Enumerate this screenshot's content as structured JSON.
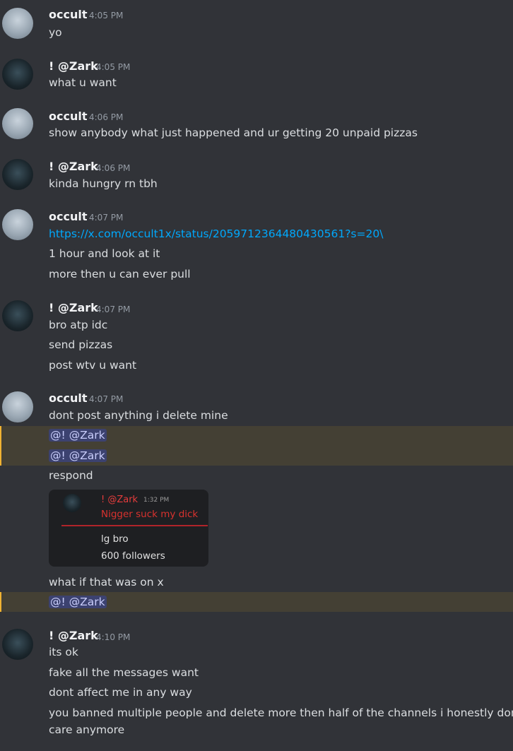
{
  "messages": [
    {
      "author": "occult",
      "time": "4:05 PM",
      "lines": [
        "yo"
      ]
    },
    {
      "author": "! @Zark",
      "time": "4:05 PM",
      "lines": [
        "what u want"
      ]
    },
    {
      "author": "occult",
      "time": "4:06 PM",
      "lines": [
        "show anybody what just happened and ur getting 20 unpaid pizzas"
      ]
    },
    {
      "author": "! @Zark",
      "time": "4:06 PM",
      "lines": [
        "kinda hungry rn tbh"
      ]
    },
    {
      "author": "occult",
      "time": "4:07 PM",
      "link": "https://x.com/occult1x/status/2059712364480430561?s=20\\",
      "lines": [
        "1 hour and look at it",
        "more then u can ever pull"
      ]
    },
    {
      "author": "! @Zark",
      "time": "4:07 PM",
      "lines": [
        "bro atp idc",
        "send pizzas",
        "post wtv u want"
      ]
    },
    {
      "author": "occult",
      "time": "4:07 PM",
      "lines": [
        "dont post anything i delete mine",
        "respond",
        "what if that was on x"
      ],
      "mentions": [
        "@! @Zark",
        "@! @Zark",
        "@! @Zark"
      ]
    },
    {
      "author": "! @Zark",
      "time": "4:10 PM",
      "lines": [
        "its ok",
        "fake all the messages want",
        "dont affect me in any way",
        "you banned multiple people and delete more then half of the channels i honestly don't",
        "care anymore"
      ]
    }
  ],
  "embed": {
    "author": "! @Zark",
    "time": "1:32 PM",
    "message": "Nigger suck my dick",
    "line1": "lg bro",
    "line2": "600 followers"
  }
}
